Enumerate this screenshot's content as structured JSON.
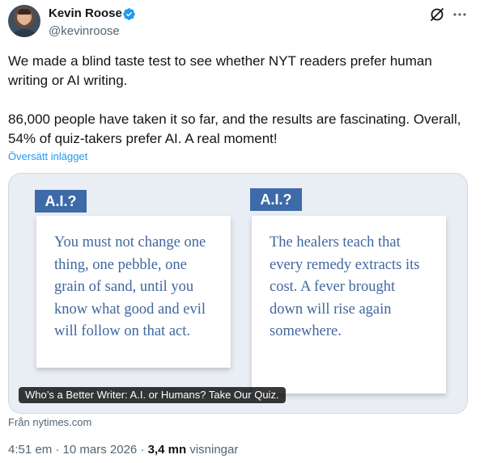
{
  "author": {
    "display_name": "Kevin Roose",
    "handle": "@kevinroose",
    "verified_color": "#1d9bf0"
  },
  "icons": {
    "grok": "grok-slash-icon",
    "more": "more-horizontal-icon",
    "verified": "verified-badge-icon"
  },
  "tweet": {
    "text": "We made a blind taste test to see whether NYT readers prefer human writing or AI writing.\n\n86,000 people have taken it so far, and the results are fascinating. Overall, 54% of quiz-takers prefer AI. A real moment!",
    "translate_label": "Översätt inlägget"
  },
  "card": {
    "left_tag": "A.I.?",
    "right_tag": "A.I.?",
    "left_passage": "You must not change one thing, one pebble, one grain of sand, until you know what good and evil will follow on that act.",
    "right_passage": "The healers teach that every remedy extracts its cost. A fever brought down will rise again somewhere.",
    "caption": "Who’s a Better Writer: A.I. or Humans? Take Our Quiz.",
    "source": "Från nytimes.com",
    "tag_color": "#3d6aa8",
    "text_color": "#40679f"
  },
  "meta": {
    "time": "4:51 em",
    "date": "10 mars 2026",
    "views_count": "3,4 mn",
    "views_label": "visningar"
  }
}
